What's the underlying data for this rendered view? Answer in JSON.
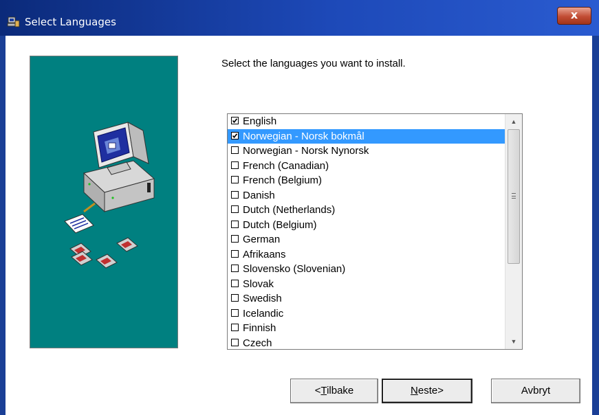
{
  "window": {
    "title": "Select Languages",
    "close_label": "x"
  },
  "instruction": "Select the languages you want to install.",
  "languages": [
    {
      "label": "English",
      "checked": true,
      "selected": false
    },
    {
      "label": "Norwegian - Norsk bokmål",
      "checked": true,
      "selected": true
    },
    {
      "label": "Norwegian - Norsk Nynorsk",
      "checked": false,
      "selected": false
    },
    {
      "label": "French (Canadian)",
      "checked": false,
      "selected": false
    },
    {
      "label": "French (Belgium)",
      "checked": false,
      "selected": false
    },
    {
      "label": "Danish",
      "checked": false,
      "selected": false
    },
    {
      "label": "Dutch (Netherlands)",
      "checked": false,
      "selected": false
    },
    {
      "label": "Dutch (Belgium)",
      "checked": false,
      "selected": false
    },
    {
      "label": "German",
      "checked": false,
      "selected": false
    },
    {
      "label": "Afrikaans",
      "checked": false,
      "selected": false
    },
    {
      "label": "Slovensko (Slovenian)",
      "checked": false,
      "selected": false
    },
    {
      "label": "Slovak",
      "checked": false,
      "selected": false
    },
    {
      "label": "Swedish",
      "checked": false,
      "selected": false
    },
    {
      "label": "Icelandic",
      "checked": false,
      "selected": false
    },
    {
      "label": "Finnish",
      "checked": false,
      "selected": false
    },
    {
      "label": "Czech",
      "checked": false,
      "selected": false
    }
  ],
  "scrollbar": {
    "position_fraction": 0.0,
    "visible_fraction": 0.6
  },
  "buttons": {
    "back": {
      "accel": "T",
      "prefix": "<",
      "rest": "ilbake"
    },
    "next": {
      "accel": "N",
      "rest": "este>"
    },
    "cancel": {
      "label": "Avbryt"
    }
  },
  "colors": {
    "panel": "#008080",
    "selection": "#3399ff",
    "titlebar": "#1d49b8"
  },
  "icons": [
    "installer-app-icon",
    "computer-icon",
    "document-icon",
    "floppy-disk-icon",
    "scroll-up-arrow-icon",
    "scroll-down-arrow-icon",
    "thumb-grip-icon"
  ]
}
